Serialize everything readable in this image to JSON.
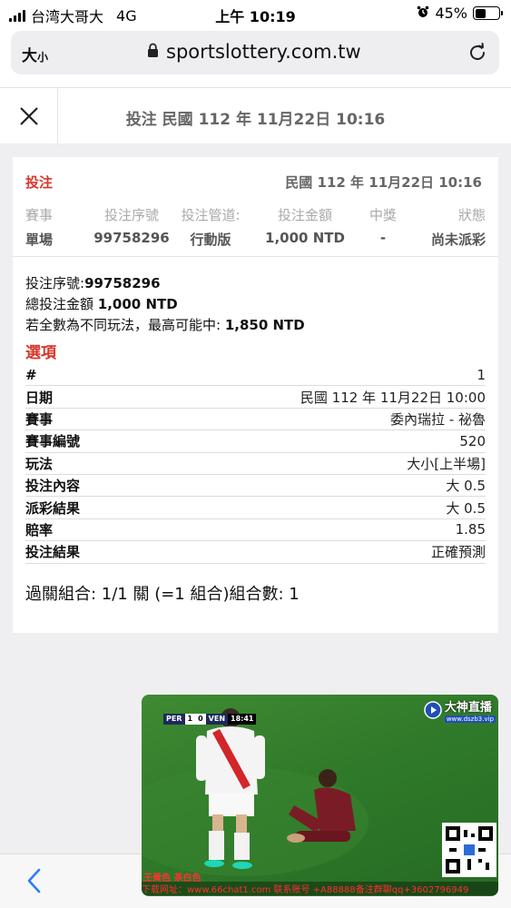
{
  "status_bar": {
    "carrier": "台湾大哥大",
    "network": "4G",
    "time": "上午 10:19",
    "battery": "45%",
    "battery_level": 0.45
  },
  "browser": {
    "text_size_label": "大",
    "text_size_small": "小",
    "url": "sportslottery.com.tw"
  },
  "header": {
    "title": "投注 民國 112 年 11月22日 10:16"
  },
  "bet": {
    "label": "投注",
    "date": "民國 112 年 11月22日 10:16",
    "columns": [
      {
        "header": "賽事",
        "value": "單場"
      },
      {
        "header": "投注序號",
        "value": "99758296"
      },
      {
        "header": "投注管道:",
        "value": "行動版"
      },
      {
        "header": "投注金額",
        "value": "1,000 NTD"
      },
      {
        "header": "中獎",
        "value": "-"
      },
      {
        "header": "狀態",
        "value": "尚未派彩"
      }
    ]
  },
  "summary": {
    "serial_label": "投注序號:",
    "serial_value": "99758296",
    "total_label": "總投注金額 ",
    "total_value": "1,000 NTD",
    "max_label": "若全數為不同玩法，最高可能中: ",
    "max_value": "1,850 NTD"
  },
  "options": {
    "title": "選項",
    "rows": [
      {
        "label": "#",
        "value": "1"
      },
      {
        "label": "日期",
        "value": "民國 112 年 11月22日 10:00"
      },
      {
        "label": "賽事",
        "value": "委內瑞拉 - 祕魯"
      },
      {
        "label": "賽事編號",
        "value": "520"
      },
      {
        "label": "玩法",
        "value": "大小[上半場]"
      },
      {
        "label": "投注內容",
        "value": "大 0.5"
      },
      {
        "label": "派彩結果",
        "value": "大 0.5"
      },
      {
        "label": "賠率",
        "value": "1.85"
      },
      {
        "label": "投注結果",
        "value": "正確預測"
      }
    ],
    "parlay": "過關組合: 1/1 關 (=1 組合)組合數: 1"
  },
  "video": {
    "team1": "PER",
    "score1": "1",
    "score2": "0",
    "team2": "VEN",
    "clock": "18:41",
    "logo_text": "大神直播",
    "logo_url": "www.dszb3.vip",
    "banner_line1": "王黃色 茶白色",
    "banner_line2": "下载网址：www.66chat1.com 联系账号 +A88888备注群聊qq+3602796949"
  }
}
